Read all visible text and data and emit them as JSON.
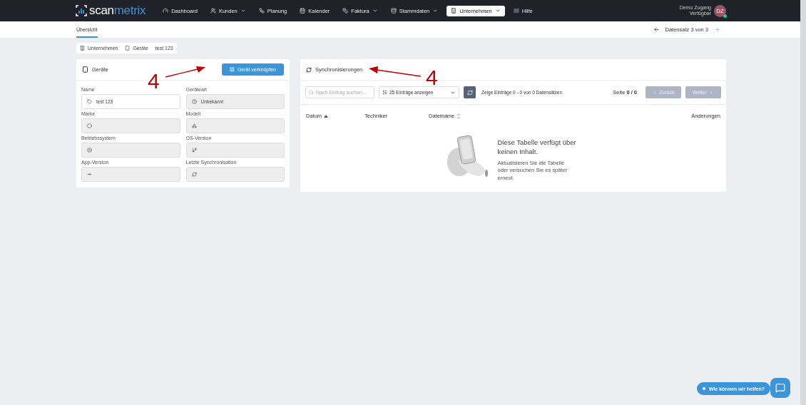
{
  "navbar": {
    "logo_left": "scan",
    "logo_right": "metrix",
    "items": [
      {
        "label": "Dashboard",
        "kind": "link",
        "selected": false
      },
      {
        "label": "Kunden",
        "kind": "dropdown",
        "selected": false
      },
      {
        "label": "Planung",
        "kind": "link",
        "selected": false
      },
      {
        "label": "Kalender",
        "kind": "link",
        "selected": false
      },
      {
        "label": "Faktura",
        "kind": "dropdown",
        "selected": false
      },
      {
        "label": "Stammdaten",
        "kind": "dropdown",
        "selected": false
      },
      {
        "label": "Unternehmen",
        "kind": "dropdown",
        "selected": true
      },
      {
        "label": "Hilfe",
        "kind": "link",
        "selected": false
      }
    ],
    "user": {
      "name": "Demo Zugang",
      "status": "Verfügbar",
      "initials": "DZ",
      "online": true
    }
  },
  "subnav": {
    "tabs": [
      {
        "label": "Übersicht",
        "selected": true
      }
    ],
    "record": "Datensatz 3 von 3"
  },
  "breadcrumb": [
    "Unternehmen",
    "Geräte",
    "test 123"
  ],
  "device_card": {
    "title": "Geräte",
    "button": "Gerät verknüpfen",
    "fields": [
      {
        "label": "Name",
        "value": "test 123",
        "disabled": false
      },
      {
        "label": "Geräteart",
        "value": "Unbekannt",
        "disabled": true
      },
      {
        "label": "Marke",
        "disabled": true
      },
      {
        "label": "Modell",
        "disabled": true
      },
      {
        "label": "Betriebssystem",
        "disabled": true
      },
      {
        "label": "OS-Version",
        "disabled": true
      },
      {
        "label": "App-Version",
        "disabled": true
      },
      {
        "label": "Letzte Synchronisation",
        "disabled": true
      }
    ]
  },
  "sync_card": {
    "title": "Synchronisierungen",
    "search": {
      "placeholder": "Nach Eintrag suchen..."
    },
    "page_size": "25 Einträge anzeigen",
    "info": "Zeige Einträge 0 - 0 von 0 Datensätzen",
    "page": "Seite **0 / 0**",
    "prev": {
      "label": "Zurück",
      "disabled": true
    },
    "next": {
      "label": "Weiter",
      "disabled": true
    },
    "columns": [
      {
        "label": "Datum",
        "sorted": true,
        "sortable": true
      },
      {
        "label": "Techniker",
        "sorted": false,
        "sortable": false
      },
      {
        "label": "Dateiname",
        "sorted": false,
        "sortable": true
      },
      {
        "label": "Änderungen",
        "sorted": false,
        "sortable": false
      }
    ],
    "empty": {
      "title": "Diese Tabelle verfügt über keinen Inhalt.",
      "text": "Aktualisieren Sie die Tabelle oder versuchen Sie es später erneut."
    }
  },
  "annotations": [
    {
      "label": "4"
    },
    {
      "label": "4"
    }
  ],
  "chat": {
    "label": "Wie können wir helfen?"
  }
}
